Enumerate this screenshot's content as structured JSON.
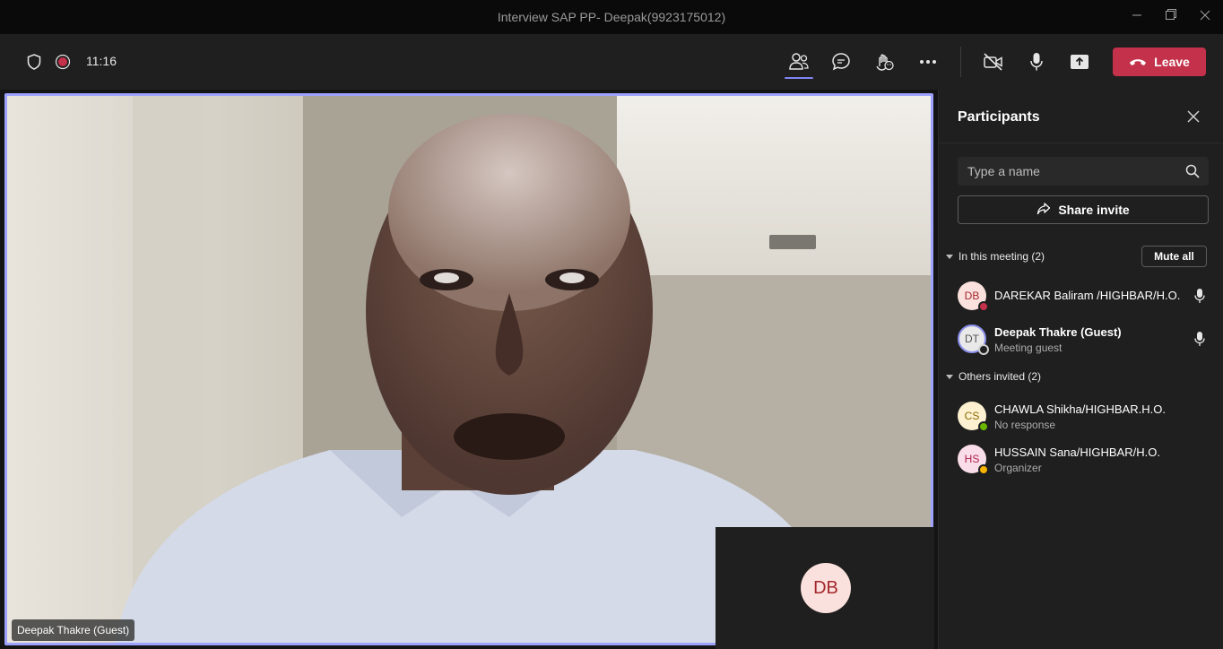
{
  "window": {
    "title": "Interview SAP PP- Deepak(9923175012)"
  },
  "toolbar": {
    "timer": "11:16",
    "leave_label": "Leave",
    "icons": [
      "shield-icon",
      "recording-icon",
      "people-icon",
      "chat-icon",
      "reactions-icon",
      "more-icon",
      "camera-off-icon",
      "microphone-icon",
      "share-screen-icon",
      "hang-up-icon"
    ],
    "colors": {
      "accent": "#7f85f5",
      "leave": "#c4314b",
      "recording": "#c4314b"
    }
  },
  "stage": {
    "speaker_name": "Deepak Thakre (Guest)",
    "self_initials": "DB"
  },
  "panel": {
    "title": "Participants",
    "search_placeholder": "Type a name",
    "share_invite_label": "Share invite",
    "in_meeting_label": "In this meeting (2)",
    "mute_all_label": "Mute all",
    "others_label": "Others invited (2)",
    "in_meeting": [
      {
        "initials": "DB",
        "name": "DAREKAR Baliram /HIGHBAR/H.O.",
        "sub": "",
        "status": "busy"
      },
      {
        "initials": "DT",
        "name": "Deepak Thakre (Guest)",
        "sub": "Meeting guest",
        "status": "offline"
      }
    ],
    "others": [
      {
        "initials": "CS",
        "name": "CHAWLA Shikha/HIGHBAR.H.O.",
        "sub": "No response",
        "status": "available"
      },
      {
        "initials": "HS",
        "name": "HUSSAIN Sana/HIGHBAR/H.O.",
        "sub": "Organizer",
        "status": "away"
      }
    ]
  }
}
